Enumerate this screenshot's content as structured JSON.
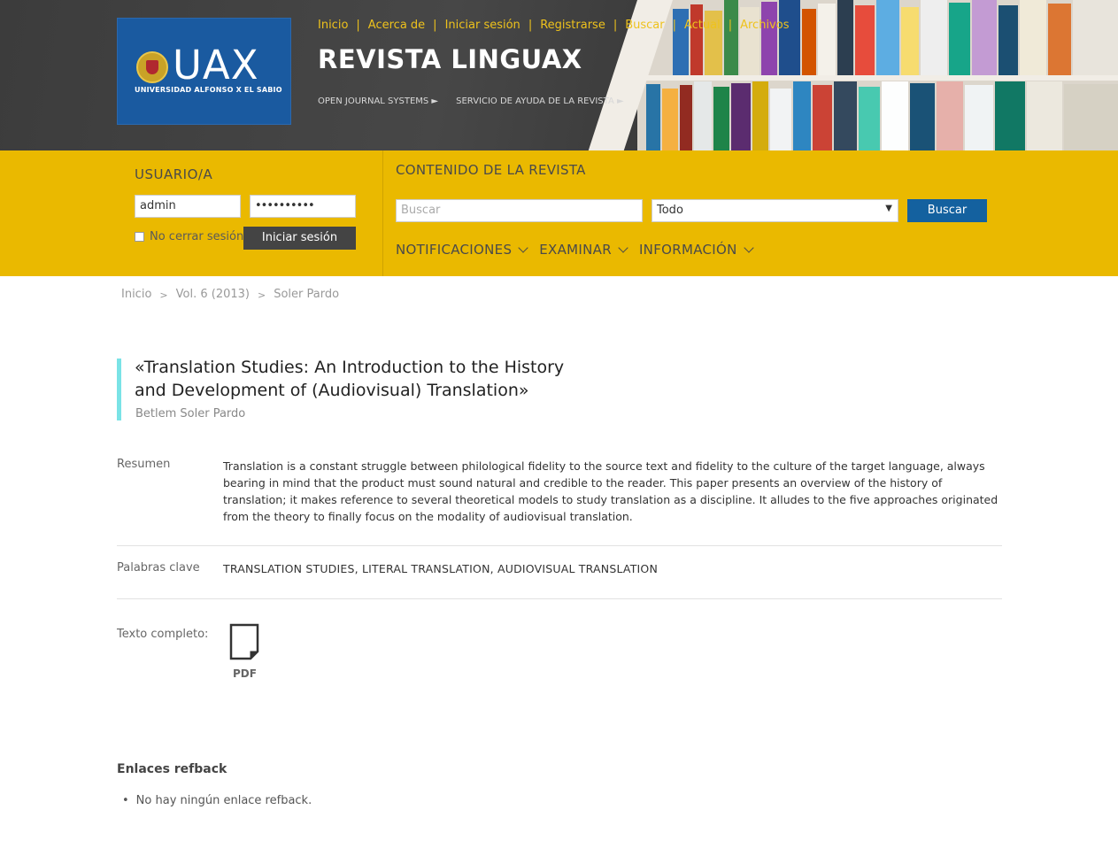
{
  "header": {
    "logo_text": "UAX",
    "logo_sub": "UNIVERSIDAD ALFONSO X EL SABIO",
    "nav": [
      "Inicio",
      "Acerca de",
      "Iniciar sesión",
      "Registrarse",
      "Buscar",
      "Actual",
      "Archivos"
    ],
    "site_title": "REVISTA LINGUAX",
    "subnav": [
      "OPEN JOURNAL SYSTEMS ►",
      "SERVICIO DE AYUDA DE LA REVISTA ►"
    ]
  },
  "login": {
    "title": "USUARIO/A",
    "username": "admin",
    "password": "••••••••••",
    "remember_label": "No cerrar sesión",
    "button": "Iniciar sesión"
  },
  "journal_content": {
    "title": "CONTENIDO DE LA REVISTA",
    "search_placeholder": "Buscar",
    "scope_value": "Todo",
    "search_button": "Buscar",
    "menu": [
      "NOTIFICACIONES",
      "EXAMINAR",
      "INFORMACIÓN"
    ]
  },
  "breadcrumb": [
    "Inicio",
    "Vol. 6 (2013)",
    "Soler Pardo"
  ],
  "article": {
    "title_line1": "«Translation Studies: An Introduction to the History",
    "title_line2": "and Development of (Audiovisual) Translation»",
    "author": "Betlem Soler Pardo",
    "abstract_label": "Resumen",
    "abstract": "Translation is a constant struggle between philological fidelity to the source text and fidelity to the culture of the target language, always bearing in mind that the product must sound natural and credible to the reader. This paper presents an overview of the history of translation; it makes reference to several theoretical models to study translation as a discipline. It alludes to the five approaches originated from the theory to finally focus on the modality of audiovisual translation.",
    "keywords_label": "Palabras clave",
    "keywords": "TRANSLATION STUDIES, LITERAL TRANSLATION, AUDIOVISUAL TRANSLATION",
    "fulltext_label": "Texto completo:",
    "pdf_label": "PDF"
  },
  "refback": {
    "title": "Enlaces refback",
    "item": "No hay ningún enlace refback."
  },
  "icons": [
    "pdf-file-icon",
    "chevron-down-icon",
    "checkbox",
    "university-seal-icon"
  ]
}
